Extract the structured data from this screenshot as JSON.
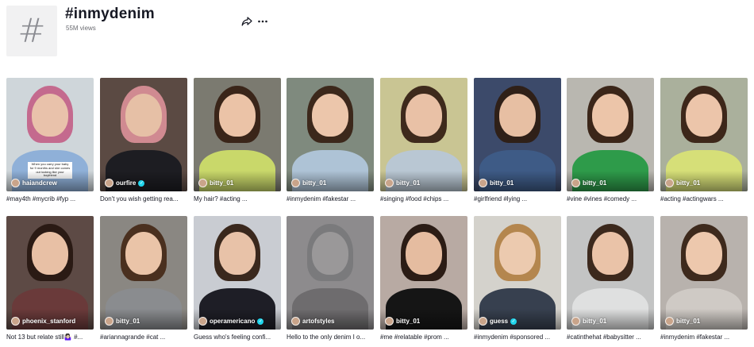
{
  "tag": {
    "title": "#inmydenim",
    "views": "55M views",
    "thumb_icon": "hash-icon"
  },
  "actions": {
    "share_icon": "share-icon",
    "more_icon": "more-icon"
  },
  "videos": [
    {
      "author": "haiandcrew",
      "verified": false,
      "caption": "#may4th #mycrib #fyp ...",
      "overlay": "When you carry your baby for 9 months and she comes out looking like your boyfriend",
      "bg": "#cfd6da",
      "hair": "#c46a8e",
      "skin": "#e9c2ab",
      "cloth": "#8fb0d8"
    },
    {
      "author": "ourfire",
      "verified": true,
      "caption": "Don't you wish getting rea...",
      "overlay": "",
      "bg": "#5b4a43",
      "hair": "#d08a91",
      "skin": "#e6c0a6",
      "cloth": "#1d1d22"
    },
    {
      "author": "bitty_01",
      "verified": false,
      "caption": "My hair? #acting ...",
      "overlay": "",
      "bg": "#7b7a70",
      "hair": "#3a2519",
      "skin": "#ebc3a7",
      "cloth": "#c9d86a"
    },
    {
      "author": "bitty_01",
      "verified": false,
      "caption": "#inmydenim #fakestar ...",
      "overlay": "",
      "bg": "#7f8a7e",
      "hair": "#3c281b",
      "skin": "#ecc6ab",
      "cloth": "#aec3d6"
    },
    {
      "author": "bitty_01",
      "verified": false,
      "caption": "#singing #food #chips ...",
      "overlay": "",
      "bg": "#c9c593",
      "hair": "#3e2a1c",
      "skin": "#e9c1a6",
      "cloth": "#b9c7d3"
    },
    {
      "author": "bitty_01",
      "verified": false,
      "caption": "#girlfriend #lying ...",
      "overlay": "",
      "bg": "#3c4a6a",
      "hair": "#2f2018",
      "skin": "#e7bfa3",
      "cloth": "#3e5b86"
    },
    {
      "author": "bitty_01",
      "verified": false,
      "caption": "#vine #vines #comedy ...",
      "overlay": "",
      "bg": "#b9b7b0",
      "hair": "#3b2619",
      "skin": "#ecc5a9",
      "cloth": "#2e9b4a"
    },
    {
      "author": "bitty_01",
      "verified": false,
      "caption": "#acting #actingwars ...",
      "overlay": "",
      "bg": "#aab09c",
      "hair": "#3d271a",
      "skin": "#ecc5aa",
      "cloth": "#d6df78"
    },
    {
      "author": "phoenix_stanford",
      "verified": false,
      "caption": "Not 13 but relate still🤷🏻‍♀️ #...",
      "overlay": "",
      "bg": "#5d4a45",
      "hair": "#2a1a14",
      "skin": "#e8c0a5",
      "cloth": "#6a3a3a"
    },
    {
      "author": "bitty_01",
      "verified": false,
      "caption": "#ariannagrande #cat ...",
      "overlay": "",
      "bg": "#8a8782",
      "hair": "#4a301f",
      "skin": "#eac4a8",
      "cloth": "#8a8c8f"
    },
    {
      "author": "operamericano",
      "verified": true,
      "caption": "Guess who's feeling confi...",
      "overlay": "",
      "bg": "#c9ccd2",
      "hair": "#3a281d",
      "skin": "#e8c2a8",
      "cloth": "#1e1e26"
    },
    {
      "author": "artofstyles",
      "verified": false,
      "caption": "Hello to the only denim I o...",
      "overlay": "",
      "bg": "#8d8b8d",
      "hair": "#7a7a7c",
      "skin": "#9a9899",
      "cloth": "#6e6c6e"
    },
    {
      "author": "bitty_01",
      "verified": false,
      "caption": "#me #relatable #prom ...",
      "overlay": "",
      "bg": "#b8aaa3",
      "hair": "#2b1c15",
      "skin": "#e5bca0",
      "cloth": "#151515"
    },
    {
      "author": "guess",
      "verified": true,
      "caption": "#inmydenim #sponsored ...",
      "overlay": "",
      "bg": "#d4d2cc",
      "hair": "#b4864e",
      "skin": "#eccaaf",
      "cloth": "#37404f"
    },
    {
      "author": "bitty_01",
      "verified": false,
      "caption": "#catinthehat #babysitter ...",
      "overlay": "",
      "bg": "#c3c4c4",
      "hair": "#3c291d",
      "skin": "#eac3a8",
      "cloth": "#dfe0e0"
    },
    {
      "author": "bitty_01",
      "verified": false,
      "caption": "#inmydenim #fakestar ...",
      "overlay": "",
      "bg": "#b8b2ad",
      "hair": "#3e2a1d",
      "skin": "#edc8ad",
      "cloth": "#cfcac5"
    }
  ]
}
